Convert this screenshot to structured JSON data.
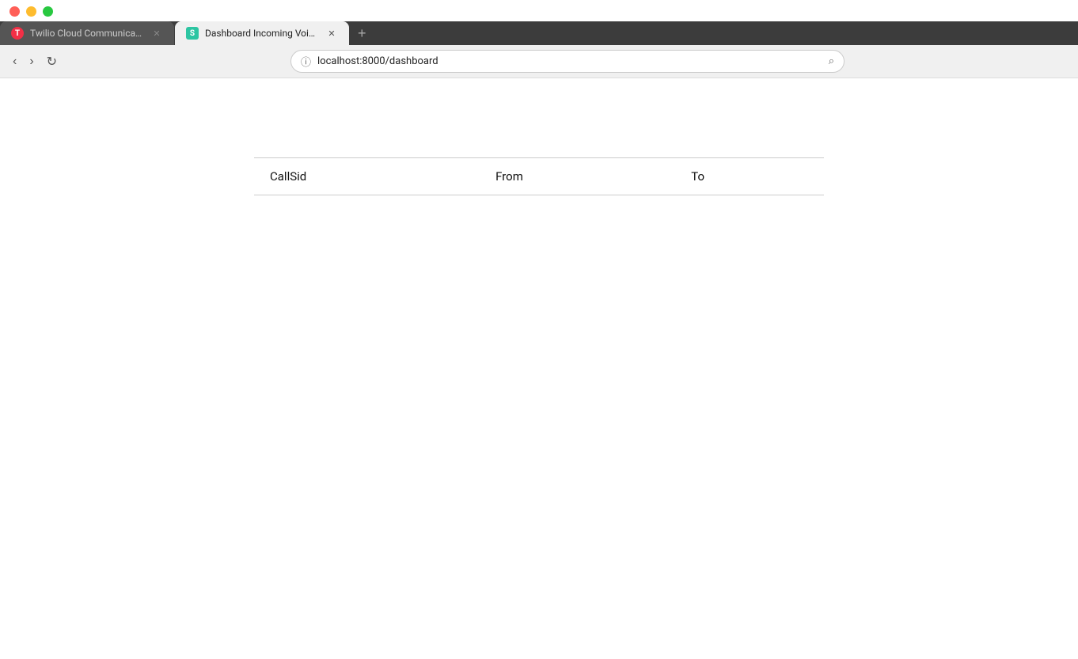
{
  "browser": {
    "tabs": [
      {
        "id": "twilio",
        "title": "Twilio Cloud Communications",
        "favicon_type": "twilio",
        "favicon_label": "T",
        "active": false,
        "closeable": true
      },
      {
        "id": "dashboard",
        "title": "Dashboard Incoming Voice Cal",
        "favicon_type": "dashboard",
        "favicon_label": "S",
        "active": true,
        "closeable": true
      }
    ],
    "new_tab_label": "+",
    "address_bar": {
      "url": "localhost:8000/dashboard",
      "icon": "🔒"
    },
    "nav": {
      "back_label": "‹",
      "forward_label": "›",
      "reload_label": "↻"
    }
  },
  "table": {
    "columns": [
      {
        "key": "callsid",
        "label": "CallSid"
      },
      {
        "key": "from",
        "label": "From"
      },
      {
        "key": "to",
        "label": "To"
      }
    ],
    "rows": []
  }
}
